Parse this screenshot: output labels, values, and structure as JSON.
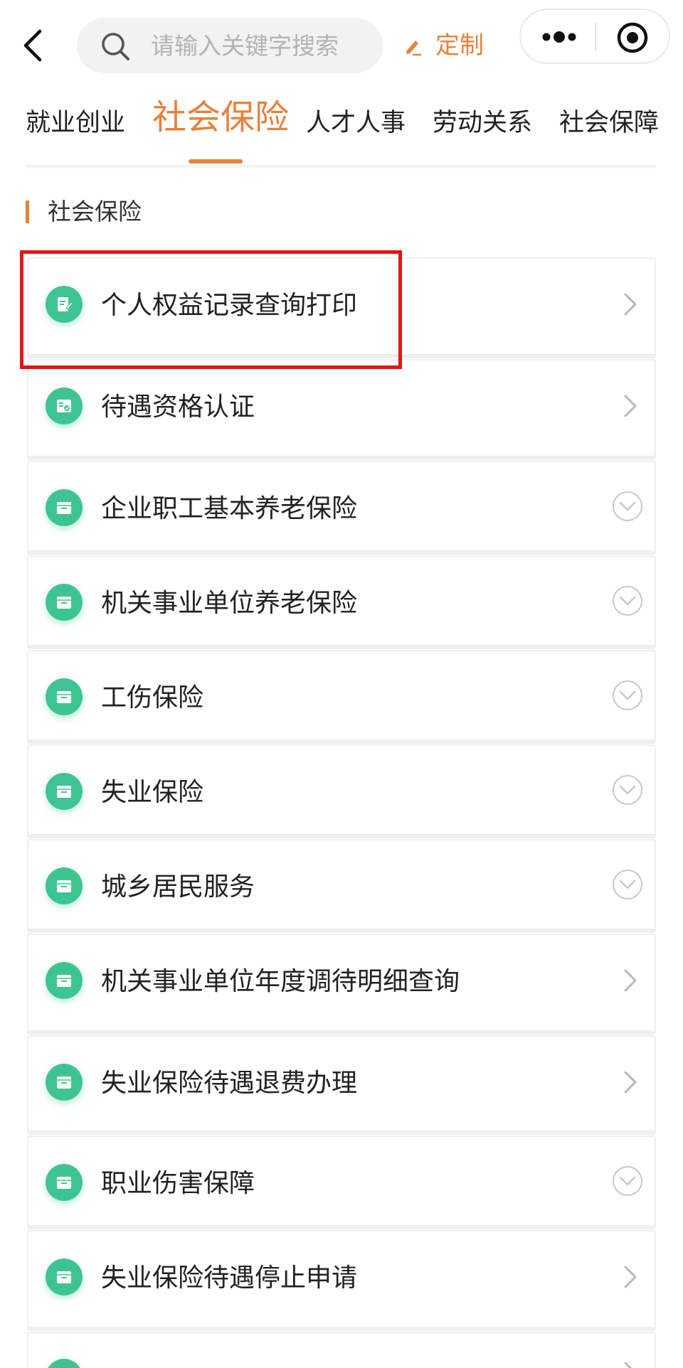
{
  "search": {
    "placeholder": "请输入关键字搜索"
  },
  "toolbar": {
    "custom_label": "定制"
  },
  "tabs": [
    {
      "label": "就业创业",
      "active": false
    },
    {
      "label": "社会保险",
      "active": true
    },
    {
      "label": "人才人事",
      "active": false
    },
    {
      "label": "劳动关系",
      "active": false
    },
    {
      "label": "社会保障",
      "active": false
    }
  ],
  "section": {
    "title": "社会保险"
  },
  "items": [
    {
      "label": "个人权益记录查询打印",
      "icon": "document-edit-icon",
      "action": "chevron-right"
    },
    {
      "label": "待遇资格认证",
      "icon": "id-card-check-icon",
      "action": "chevron-right"
    },
    {
      "label": "企业职工基本养老保险",
      "icon": "folder-box-icon",
      "action": "expand-down"
    },
    {
      "label": "机关事业单位养老保险",
      "icon": "folder-box-icon",
      "action": "expand-down"
    },
    {
      "label": "工伤保险",
      "icon": "folder-box-icon",
      "action": "expand-down"
    },
    {
      "label": "失业保险",
      "icon": "folder-box-icon",
      "action": "expand-down"
    },
    {
      "label": "城乡居民服务",
      "icon": "folder-box-icon",
      "action": "expand-down"
    },
    {
      "label": "机关事业单位年度调待明细查询",
      "icon": "folder-box-icon",
      "action": "chevron-right"
    },
    {
      "label": "失业保险待遇退费办理",
      "icon": "folder-box-icon",
      "action": "chevron-right"
    },
    {
      "label": "职业伤害保障",
      "icon": "folder-box-icon",
      "action": "expand-down"
    },
    {
      "label": "失业保险待遇停止申请",
      "icon": "folder-box-icon",
      "action": "chevron-right"
    },
    {
      "label": "",
      "icon": "folder-box-icon",
      "action": "chevron-right"
    }
  ],
  "colors": {
    "accent": "#e8813a",
    "icon_green": "#3ec493",
    "highlight_red": "#e21616"
  }
}
